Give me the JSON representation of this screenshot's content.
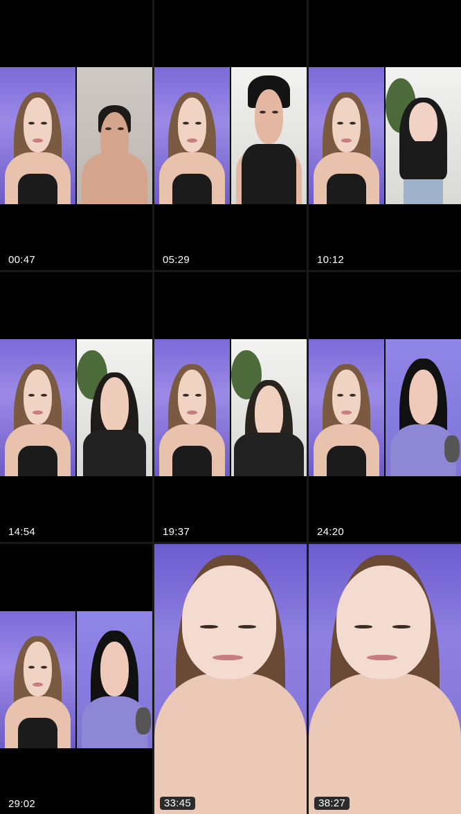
{
  "thumbnails": [
    {
      "time": "00:47",
      "left": {
        "hair": "#7a5a40",
        "bg": "purple"
      },
      "right": {
        "hair": "#1e1a17",
        "bg": "grey",
        "skin": "#d4a48c"
      }
    },
    {
      "time": "05:29",
      "left": {
        "hair": "#7a5a40",
        "bg": "purple"
      },
      "right": {
        "hair": "#141414",
        "bg": "white",
        "skin": "#e3b7a2"
      }
    },
    {
      "time": "10:12",
      "left": {
        "hair": "#7a5a40",
        "bg": "purple"
      },
      "right": {
        "hair": "#1b1b1b",
        "bg": "white",
        "skin": "#f1d2c4"
      }
    },
    {
      "time": "14:54",
      "left": {
        "hair": "#7a5a40",
        "bg": "purple"
      },
      "right": {
        "hair": "#1f1b18",
        "bg": "white",
        "skin": "#efcdbb"
      }
    },
    {
      "time": "19:37",
      "left": {
        "hair": "#7a5a40",
        "bg": "purple"
      },
      "right": {
        "hair": "#2a2420",
        "bg": "white",
        "skin": "#f0d0bf"
      }
    },
    {
      "time": "24:20",
      "left": {
        "hair": "#7a5a40",
        "bg": "purple"
      },
      "right": {
        "hair": "#111",
        "bg": "lav",
        "skin": "#efcabb"
      }
    },
    {
      "time": "29:02",
      "left": {
        "hair": "#7a5a40",
        "bg": "purple"
      },
      "right": {
        "hair": "#111",
        "bg": "lav",
        "skin": "#efcabb"
      }
    },
    {
      "time": "33:45",
      "full": true
    },
    {
      "time": "38:27",
      "full": true
    }
  ]
}
